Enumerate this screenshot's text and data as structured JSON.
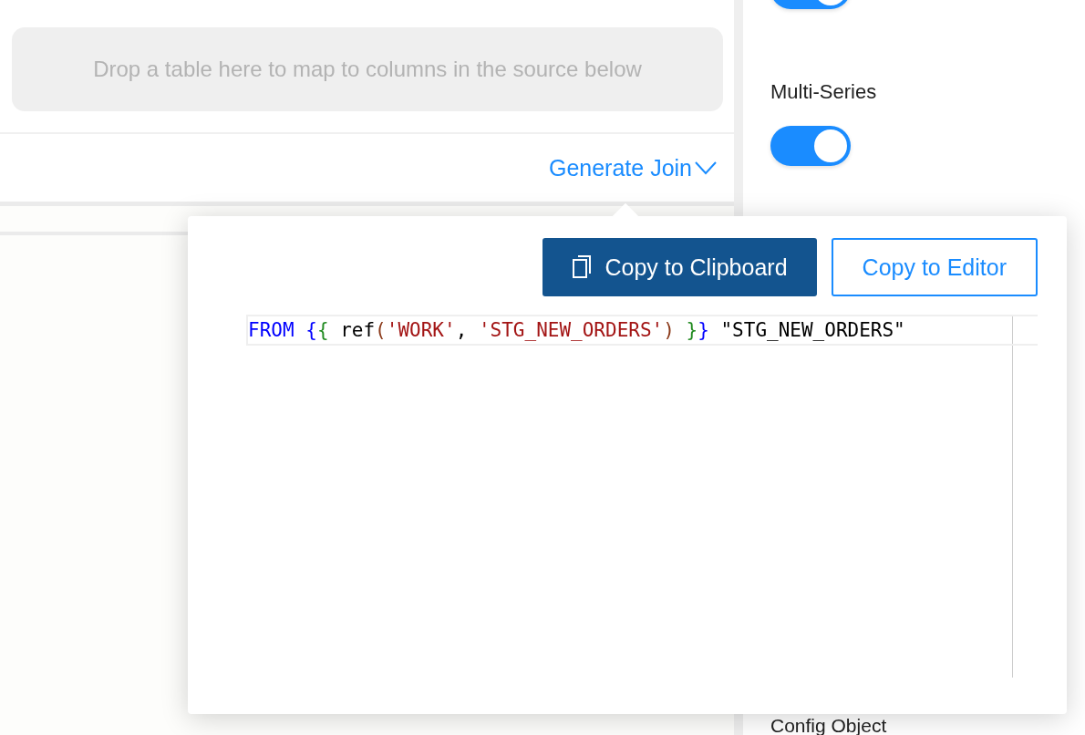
{
  "drop_zone": {
    "placeholder": "Drop a table here to map to columns in the source below"
  },
  "generate_join": {
    "label": "Generate Join",
    "expanded": true
  },
  "settings": [
    {
      "kind": "toggle",
      "on": true
    },
    {
      "kind": "toggle",
      "label": "Multi-Series",
      "on": true
    }
  ],
  "bottom_label": "Config Object",
  "popover": {
    "buttons": [
      {
        "kind": "primary",
        "label": "Copy to Clipboard"
      },
      {
        "kind": "secondary",
        "label": "Copy to Editor"
      }
    ],
    "code": [
      {
        "text": "FROM",
        "kind": "keyword"
      },
      {
        "text": " {",
        "kind": "brace"
      },
      {
        "text": "{",
        "kind": "brace2"
      },
      {
        "text": " ref",
        "kind": "plain"
      },
      {
        "text": "(",
        "kind": "paren"
      },
      {
        "text": "'WORK'",
        "kind": "string"
      },
      {
        "text": ", ",
        "kind": "plain"
      },
      {
        "text": "'STG_NEW_ORDERS'",
        "kind": "string"
      },
      {
        "text": ") ",
        "kind": "paren"
      },
      {
        "text": "}",
        "kind": "brace2"
      },
      {
        "text": "}",
        "kind": "brace"
      },
      {
        "text": " \"STG_NEW_ORDERS\"",
        "kind": "plain"
      }
    ]
  }
}
